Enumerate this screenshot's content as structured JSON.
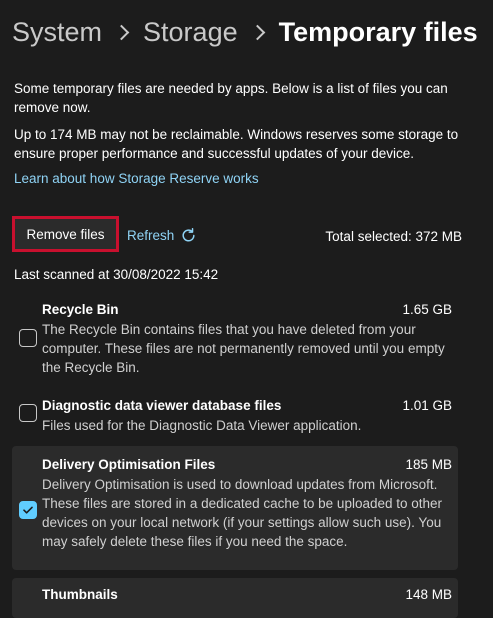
{
  "breadcrumb": {
    "items": [
      "System",
      "Storage"
    ],
    "current": "Temporary files"
  },
  "intro": {
    "text": "Some temporary files are needed by apps. Below is a list of files you can remove now.",
    "reserve_text": "Up to 174 MB may not be reclaimable. Windows reserves some storage to ensure proper performance and successful updates of your device.",
    "learn_link": "Learn about how Storage Reserve works"
  },
  "toolbar": {
    "remove_label": "Remove files",
    "refresh_label": "Refresh",
    "refresh_icon": "refresh-icon",
    "total_selected": "Total selected: 372 MB",
    "last_scanned": "Last scanned at 30/08/2022 15:42"
  },
  "items": [
    {
      "title": "Recycle Bin",
      "size": "1.65 GB",
      "description": "The Recycle Bin contains files that you have deleted from your computer. These files are not permanently removed until you empty the Recycle Bin.",
      "checked": false
    },
    {
      "title": "Diagnostic data viewer database files",
      "size": "1.01 GB",
      "description": "Files used for the Diagnostic Data Viewer application.",
      "checked": false
    },
    {
      "title": "Delivery Optimisation Files",
      "size": "185 MB",
      "description": "Delivery Optimisation is used to download updates from Microsoft. These files are stored in a dedicated cache to be uploaded to other devices on your local network (if your settings allow such use). You may safely delete these files if you need the space.",
      "checked": true
    },
    {
      "title": "Thumbnails",
      "size": "148 MB",
      "description": "",
      "checked": false
    }
  ],
  "colors": {
    "background": "#1c1c1c",
    "card": "#2b2b2b",
    "accent": "#60cdff",
    "link": "#8fd3f5",
    "highlight_border": "#c8102e"
  }
}
